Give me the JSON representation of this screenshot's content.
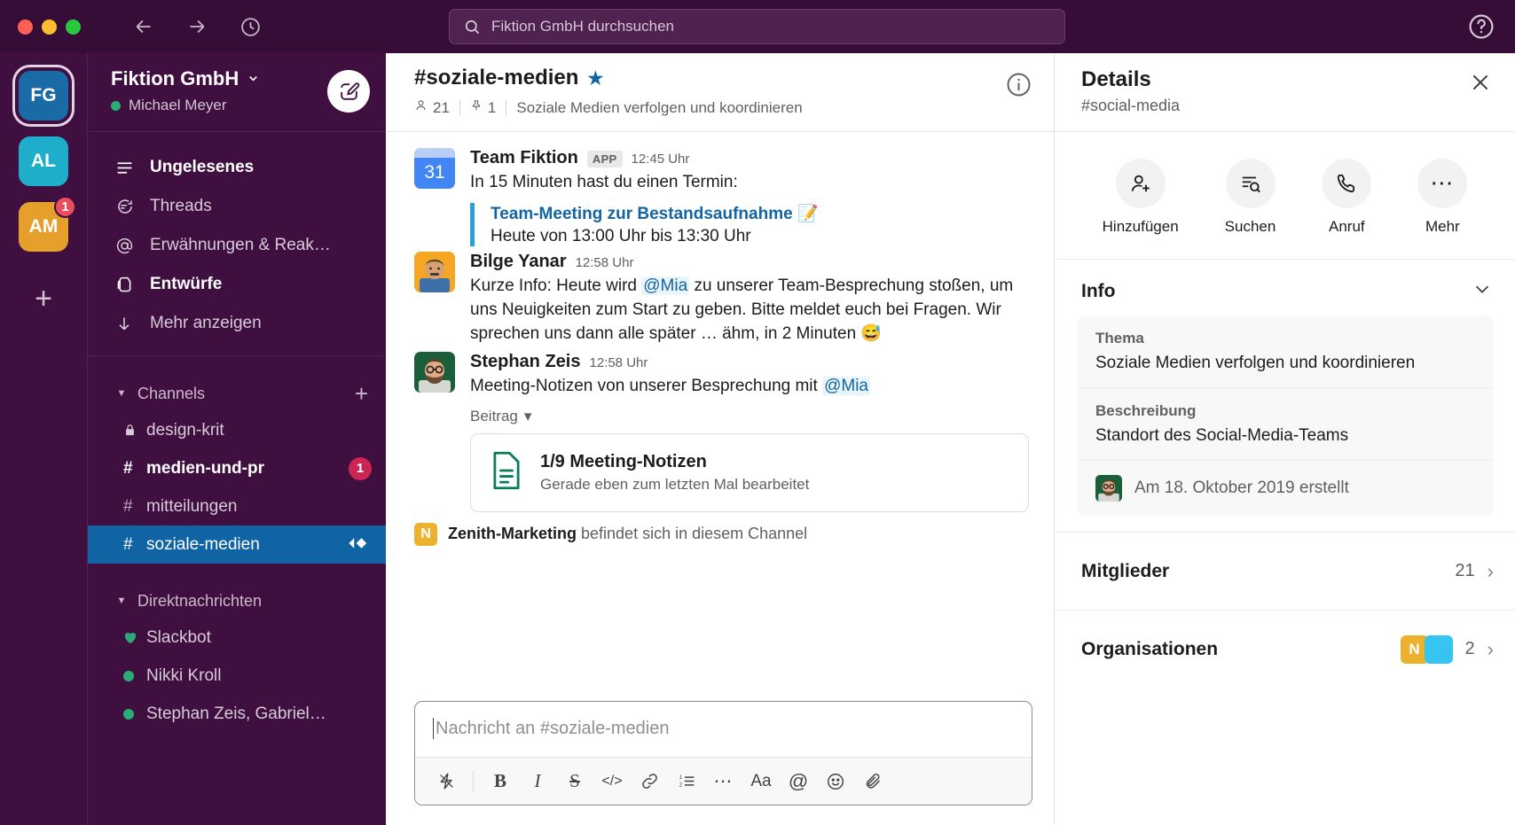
{
  "titlebar": {
    "back_icon": "arrow-left-icon",
    "forward_icon": "arrow-right-icon",
    "history_icon": "clock-icon",
    "search_placeholder": "Fiktion GmbH durchsuchen",
    "help_icon": "help-circle-icon"
  },
  "rail": {
    "workspaces": [
      {
        "initials": "FG",
        "color": "#1a6aa5",
        "badge": ""
      },
      {
        "initials": "AL",
        "color": "#1eaecb",
        "badge": ""
      },
      {
        "initials": "AM",
        "color": "#e59f2b",
        "badge": "1"
      }
    ],
    "add_label": "+"
  },
  "sidebar": {
    "workspace_name": "Fiktion GmbH",
    "user_name": "Michael Meyer",
    "compose_icon": "compose-icon",
    "nav": [
      {
        "label": "Ungelesenes",
        "icon": "unread-lines-icon",
        "bold": true
      },
      {
        "label": "Threads",
        "icon": "threads-icon",
        "bold": false
      },
      {
        "label": "Erwähnungen & Reak…",
        "icon": "at-icon",
        "bold": false
      },
      {
        "label": "Entwürfe",
        "icon": "drafts-icon",
        "bold": true
      },
      {
        "label": "Mehr anzeigen",
        "icon": "arrow-down-icon",
        "bold": false
      }
    ],
    "channels_section": {
      "label": "Channels",
      "add": "+"
    },
    "channels": [
      {
        "name": "design-krit",
        "prefix": "lock",
        "bold": false,
        "badge": "",
        "selected": false,
        "huddle": false
      },
      {
        "name": "medien-und-pr",
        "prefix": "hash",
        "bold": true,
        "badge": "1",
        "selected": false,
        "huddle": false
      },
      {
        "name": "mitteilungen",
        "prefix": "hash",
        "bold": false,
        "badge": "",
        "selected": false,
        "huddle": false
      },
      {
        "name": "soziale-medien",
        "prefix": "hash",
        "bold": false,
        "badge": "",
        "selected": true,
        "huddle": true
      }
    ],
    "dms_section": {
      "label": "Direktnachrichten"
    },
    "dms": [
      {
        "name": "Slackbot",
        "icon": "heart-icon"
      },
      {
        "name": "Nikki Kroll",
        "icon": "presence-dot-icon"
      },
      {
        "name": "Stephan Zeis, Gabriel…",
        "icon": "presence-dot-icon"
      }
    ]
  },
  "channel": {
    "title": "#soziale-medien",
    "star_icon": "star-icon",
    "members_icon": "person-icon",
    "members_count": "21",
    "pins_icon": "pin-icon",
    "pins_count": "1",
    "topic": "Soziale Medien verfolgen und koordinieren",
    "info_icon": "info-circle-icon"
  },
  "messages": [
    {
      "author": "Team Fiktion",
      "tag": "APP",
      "time": "12:45 Uhr",
      "avatar": "calendar-31-icon",
      "text": "In 15 Minuten hast du einen Termin:",
      "quote_title": "Team-Meeting zur Bestandsaufnahme",
      "quote_emoji": "📝",
      "quote_sub": "Heute von 13:00 Uhr bis 13:30 Uhr"
    },
    {
      "author": "Bilge Yanar",
      "tag": "",
      "time": "12:58 Uhr",
      "avatar": "photo-avatar-bilge",
      "text_part1": "Kurze Info: Heute wird ",
      "mention": "@Mia",
      "text_part2": " zu unserer Team-Besprechung stoßen, um uns Neuigkeiten zum Start zu geben. Bitte meldet euch bei Fragen. Wir sprechen uns dann alle später … ähm, in 2 Minuten 😅"
    },
    {
      "author": "Stephan Zeis",
      "tag": "",
      "time": "12:58 Uhr",
      "avatar": "photo-avatar-stephan",
      "text_part1": "Meeting-Notizen von unserer Besprechung mit ",
      "mention": "@Mia",
      "text_part2": "",
      "beitrag_label": "Beitrag",
      "file_title": "1/9 Meeting-Notizen",
      "file_sub": "Gerade eben zum letzten Mal bearbeitet",
      "file_icon": "document-icon"
    }
  ],
  "join_notice": {
    "org_initial": "N",
    "org_name": "Zenith-Marketing",
    "text": " befindet sich in diesem Channel"
  },
  "composer": {
    "placeholder": "Nachricht an #soziale-medien",
    "tools": [
      {
        "icon": "lightning-icon",
        "glyph": "⚡"
      },
      {
        "icon": "bold-icon",
        "glyph": "B"
      },
      {
        "icon": "italic-icon",
        "glyph": "I"
      },
      {
        "icon": "strikethrough-icon",
        "glyph": "S"
      },
      {
        "icon": "code-icon",
        "glyph": "</>"
      },
      {
        "icon": "link-icon",
        "glyph": "🔗"
      },
      {
        "icon": "ordered-list-icon",
        "glyph": "≡"
      },
      {
        "icon": "more-icon",
        "glyph": "⋯"
      },
      {
        "icon": "font-size-icon",
        "glyph": "Aa"
      },
      {
        "icon": "at-mention-icon",
        "glyph": "@"
      },
      {
        "icon": "emoji-icon",
        "glyph": "☺"
      },
      {
        "icon": "attachment-icon",
        "glyph": "📎"
      }
    ]
  },
  "details": {
    "title": "Details",
    "subtitle": "#social-media",
    "close_icon": "close-icon",
    "actions": [
      {
        "label": "Hinzufügen",
        "icon": "add-person-icon"
      },
      {
        "label": "Suchen",
        "icon": "search-list-icon"
      },
      {
        "label": "Anruf",
        "icon": "phone-icon"
      },
      {
        "label": "Mehr",
        "icon": "more-dots-icon"
      }
    ],
    "info_header": "Info",
    "info_collapse_icon": "chevron-down-icon",
    "info_rows": [
      {
        "label": "Thema",
        "value": "Soziale Medien verfolgen und koordinieren"
      },
      {
        "label": "Beschreibung",
        "value": "Standort des Social-Media-Teams"
      }
    ],
    "created_text": "Am 18. Oktober 2019 erstellt",
    "created_avatar": "photo-avatar-stephan",
    "sections": [
      {
        "name": "Mitglieder",
        "count": "21",
        "chev": "›",
        "orgs": []
      },
      {
        "name": "Organisationen",
        "count": "2",
        "chev": "›",
        "orgs": [
          {
            "initial": "N",
            "color": "#ecb22e"
          },
          {
            "initial": "",
            "color": "#36c5f0"
          }
        ]
      }
    ]
  },
  "colors": {
    "sidebar_bg": "#3f0f40",
    "titlebar_bg": "#350d36",
    "selected_channel": "#1164a3",
    "accent_blue": "#1264a3",
    "badge_red": "#cd2553",
    "presence_green": "#2bac76"
  }
}
